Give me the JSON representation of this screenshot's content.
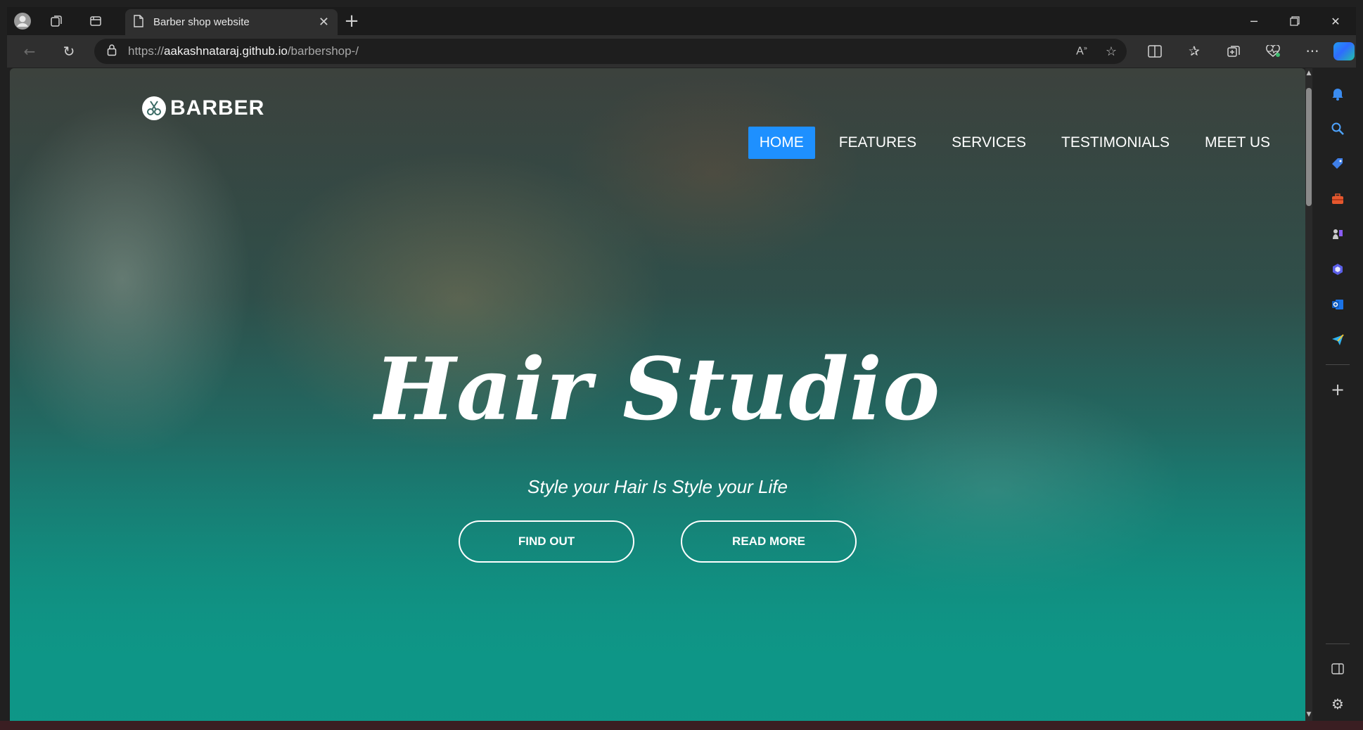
{
  "browser": {
    "tab_title": "Barber shop website",
    "url_scheme": "https://",
    "url_host": "aakashnataraj.github.io",
    "url_path": "/barbershop-/"
  },
  "site": {
    "logo_text": "BARBER",
    "nav": [
      {
        "label": "HOME",
        "active": true
      },
      {
        "label": "FEATURES",
        "active": false
      },
      {
        "label": "SERVICES",
        "active": false
      },
      {
        "label": "TESTIMONIALS",
        "active": false
      },
      {
        "label": "MEET US",
        "active": false
      }
    ],
    "hero_title": "Hair Studio",
    "hero_subtitle": "Style your Hair Is Style your Life",
    "buttons": {
      "find_out": "FIND OUT",
      "read_more": "READ MORE"
    }
  },
  "colors": {
    "nav_active": "#1e90ff",
    "hero_teal": "#0e9a88"
  },
  "icons": {
    "titlebar": [
      "profile-icon",
      "workspaces-icon",
      "tab-actions-icon",
      "page-icon",
      "close-icon",
      "new-tab-icon"
    ],
    "toolbar": [
      "back-icon",
      "refresh-icon",
      "lock-icon",
      "read-aloud-icon",
      "favorite-star-icon",
      "split-screen-icon",
      "favorites-icon",
      "collections-icon",
      "browser-essentials-icon",
      "more-icon",
      "copilot-icon"
    ],
    "sidebar": [
      "notification-bell-icon",
      "search-icon",
      "shopping-tag-icon",
      "tools-briefcase-icon",
      "games-icon",
      "microsoft365-icon",
      "outlook-icon",
      "send-icon",
      "add-icon",
      "sidebar-toggle-icon",
      "settings-gear-icon"
    ]
  }
}
